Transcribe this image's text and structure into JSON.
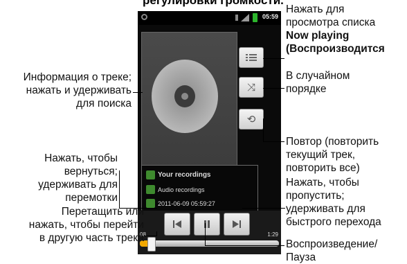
{
  "page": {
    "top_heading": "регулировки громкости."
  },
  "phone": {
    "status_bar": {
      "time": "05:59"
    },
    "track_info": {
      "title": "Your recordings",
      "album": "Audio recordings",
      "date": "2011-06-09 05:59:27"
    },
    "transport": {
      "elapsed": "08",
      "duration": "1:29",
      "progress": 0.08
    }
  },
  "callouts": {
    "now_playing_l1": "Нажать для",
    "now_playing_l2": "просмотра списка",
    "now_playing_l3": "Now playing",
    "now_playing_l4": "(Воспроизводится",
    "shuffle_l1": "В случайном",
    "shuffle_l2": "порядке",
    "repeat_l1": "Повтор (повторить",
    "repeat_l2": "текущий трек,",
    "repeat_l3": "повторить все)",
    "next_l1": "Нажать, чтобы",
    "next_l2": "пропустить;",
    "next_l3": "удерживать для",
    "next_l4": "быстрого перехода",
    "playpause_l1": "Воспроизведение/",
    "playpause_l2": "Пауза",
    "trackinfo_l1": "Информация о треке;",
    "trackinfo_l2": "нажать и удерживать",
    "trackinfo_l3": "для поиска",
    "prev_l1": "Нажать, чтобы",
    "prev_l2": "вернуться;",
    "prev_l3": "удерживать для",
    "prev_l4": "перемотки",
    "seek_l1": "Перетащить или",
    "seek_l2": "нажать, чтобы перейти",
    "seek_l3": "в другую часть трека"
  }
}
